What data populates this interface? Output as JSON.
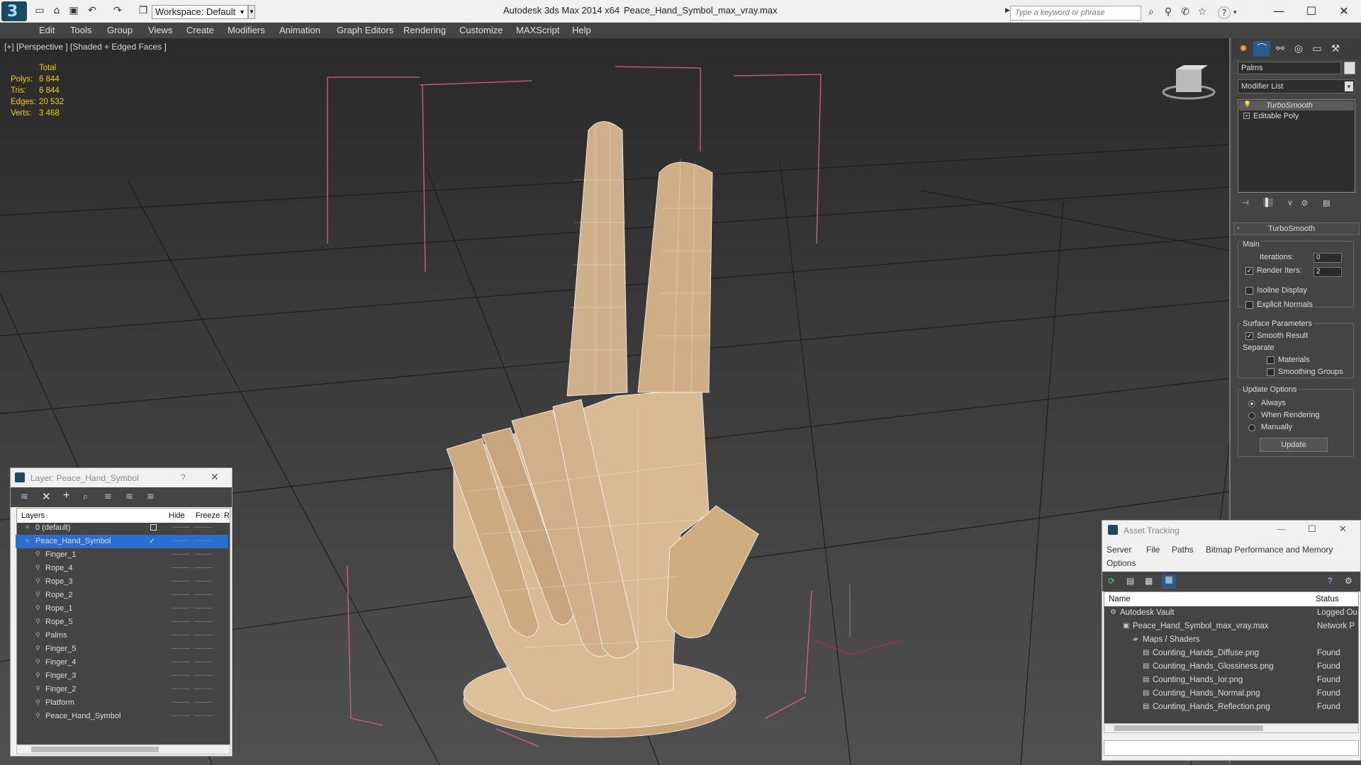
{
  "titlebar": {
    "app_title": "Autodesk 3ds Max  2014 x64",
    "file_title": "Peace_Hand_Symbol_max_vray.max",
    "workspace": "Workspace: Default",
    "search_placeholder": "Type a keyword or phrase"
  },
  "menu": [
    "Edit",
    "Tools",
    "Group",
    "Views",
    "Create",
    "Modifiers",
    "Animation",
    "Graph Editors",
    "Rendering",
    "Customize",
    "MAXScript",
    "Help"
  ],
  "viewport": {
    "label": "[+] [Perspective ] [Shaded + Edged Faces ]",
    "stats": {
      "header": "Total",
      "polys_label": "Polys:",
      "polys": "6 844",
      "tris_label": "Tris:",
      "tris": "6 844",
      "edges_label": "Edges:",
      "edges": "20 532",
      "verts_label": "Verts:",
      "verts": "3 468"
    }
  },
  "command_panel": {
    "object_name": "Palms",
    "modifier_list": "Modifier List",
    "stack": [
      "TurboSmooth",
      "Editable Poly"
    ],
    "rollout_title": "TurboSmooth",
    "main_label": "Main",
    "iterations_label": "Iterations:",
    "iterations": "0",
    "render_iters_label": "Render Iters:",
    "render_iters": "2",
    "isoline": "Isoline Display",
    "explicit": "Explicit Normals",
    "surface_params": "Surface Parameters",
    "smooth_result": "Smooth Result",
    "separate": "Separate",
    "materials": "Materials",
    "smoothing_groups": "Smoothing Groups",
    "update_options": "Update Options",
    "always": "Always",
    "when_rendering": "When Rendering",
    "manually": "Manually",
    "update_button": "Update"
  },
  "layer_window": {
    "title": "Layer: Peace_Hand_Symbol",
    "col_layers": "Layers",
    "col_hide": "Hide",
    "col_freeze": "Freeze",
    "col_r": "R",
    "rows": [
      "0 (default)",
      "Peace_Hand_Symbol",
      "Finger_1",
      "Rope_4",
      "Rope_3",
      "Rope_2",
      "Rope_1",
      "Rope_5",
      "Palms",
      "Finger_5",
      "Finger_4",
      "Finger_3",
      "Finger_2",
      "Platform",
      "Peace_Hand_Symbol"
    ]
  },
  "asset_tracking": {
    "title": "Asset Tracking",
    "menu": [
      "Server",
      "File",
      "Paths",
      "Bitmap Performance and Memory"
    ],
    "menu2": "Options",
    "col_name": "Name",
    "col_status": "Status",
    "rows": [
      {
        "name": "Autodesk Vault",
        "status": "Logged Ou"
      },
      {
        "name": "Peace_Hand_Symbol_max_vray.max",
        "status": "Network P"
      },
      {
        "name": "Maps / Shaders",
        "status": ""
      },
      {
        "name": "Counting_Hands_Diffuse.png",
        "status": "Found"
      },
      {
        "name": "Counting_Hands_Glossiness.png",
        "status": "Found"
      },
      {
        "name": "Counting_Hands_Ior.png",
        "status": "Found"
      },
      {
        "name": "Counting_Hands_Normal.png",
        "status": "Found"
      },
      {
        "name": "Counting_Hands_Reflection.png",
        "status": "Found"
      }
    ]
  }
}
